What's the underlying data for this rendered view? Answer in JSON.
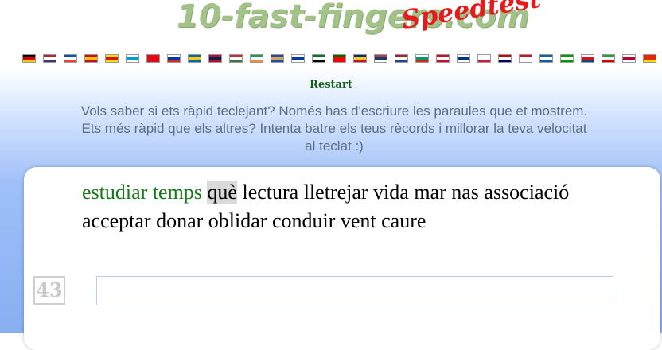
{
  "logo": {
    "main": "10-fast-fingers.com",
    "sub": "Speedtest"
  },
  "flags": [
    {
      "icon": "flag-germany-icon",
      "colors": [
        "#000000",
        "#dd0000",
        "#ffce00"
      ]
    },
    {
      "icon": "flag-usa-icon",
      "colors": [
        "#b22234",
        "#ffffff",
        "#3c3b6e"
      ]
    },
    {
      "icon": "flag-france-icon",
      "colors": [
        "#0055a4",
        "#ffffff",
        "#ef4135"
      ]
    },
    {
      "icon": "flag-spain-icon",
      "colors": [
        "#c60b1e",
        "#ffc400",
        "#c60b1e"
      ]
    },
    {
      "icon": "flag-catalonia-icon",
      "colors": [
        "#fcdd09",
        "#da121a",
        "#fcdd09"
      ]
    },
    {
      "icon": "flag-galicia-icon",
      "colors": [
        "#ffffff",
        "#0099cc",
        "#ffffff"
      ]
    },
    {
      "icon": "flag-turkey-icon",
      "colors": [
        "#e30a17",
        "#e30a17",
        "#e30a17"
      ]
    },
    {
      "icon": "flag-russia-icon",
      "colors": [
        "#ffffff",
        "#0039a6",
        "#d52b1e"
      ]
    },
    {
      "icon": "flag-sweden-icon",
      "colors": [
        "#006aa7",
        "#fecc00",
        "#006aa7"
      ]
    },
    {
      "icon": "flag-norway-icon",
      "colors": [
        "#ba0c2f",
        "#00205b",
        "#ba0c2f"
      ]
    },
    {
      "icon": "flag-hungary-icon",
      "colors": [
        "#ce2939",
        "#ffffff",
        "#477050"
      ]
    },
    {
      "icon": "flag-ireland-icon",
      "colors": [
        "#169b62",
        "#ffffff",
        "#ff883e"
      ]
    },
    {
      "icon": "flag-kosovo-icon",
      "colors": [
        "#244aa5",
        "#d0a650",
        "#244aa5"
      ]
    },
    {
      "icon": "flag-israel-icon",
      "colors": [
        "#ffffff",
        "#0038b8",
        "#ffffff"
      ]
    },
    {
      "icon": "flag-uae-icon",
      "colors": [
        "#00732f",
        "#ffffff",
        "#000000"
      ]
    },
    {
      "icon": "flag-portugal-icon",
      "colors": [
        "#006600",
        "#ff0000",
        "#ff0000"
      ]
    },
    {
      "icon": "flag-romania-icon",
      "colors": [
        "#002b7f",
        "#fcd116",
        "#ce1126"
      ]
    },
    {
      "icon": "flag-serbia-icon",
      "colors": [
        "#c6363c",
        "#0c4076",
        "#ffffff"
      ]
    },
    {
      "icon": "flag-netherlands-icon",
      "colors": [
        "#ae1c28",
        "#ffffff",
        "#21468b"
      ]
    },
    {
      "icon": "flag-bulgaria-icon",
      "colors": [
        "#ffffff",
        "#00966e",
        "#d62612"
      ]
    },
    {
      "icon": "flag-denmark-icon",
      "colors": [
        "#c8102e",
        "#ffffff",
        "#c8102e"
      ]
    },
    {
      "icon": "flag-finland-icon",
      "colors": [
        "#ffffff",
        "#003580",
        "#ffffff"
      ]
    },
    {
      "icon": "flag-poland-icon",
      "colors": [
        "#ffffff",
        "#ffffff",
        "#dc143c"
      ]
    },
    {
      "icon": "flag-malaysia-icon",
      "colors": [
        "#cc0001",
        "#ffffff",
        "#010066"
      ]
    },
    {
      "icon": "flag-indonesia-icon",
      "colors": [
        "#ce1126",
        "#ffffff",
        "#ffffff"
      ]
    },
    {
      "icon": "flag-greece-icon",
      "colors": [
        "#0d5eaf",
        "#ffffff",
        "#0d5eaf"
      ]
    },
    {
      "icon": "flag-esperanto-icon",
      "colors": [
        "#009900",
        "#ffffff",
        "#009900"
      ]
    },
    {
      "icon": "flag-czech-icon",
      "colors": [
        "#ffffff",
        "#d7141a",
        "#11457e"
      ]
    },
    {
      "icon": "flag-iran-icon",
      "colors": [
        "#239f40",
        "#ffffff",
        "#da0000"
      ]
    },
    {
      "icon": "flag-japan-icon",
      "colors": [
        "#ffffff",
        "#bc002d",
        "#ffffff"
      ]
    },
    {
      "icon": "flag-china-icon",
      "colors": [
        "#de2910",
        "#de2910",
        "#ffde00"
      ]
    }
  ],
  "restart_label": "Restart",
  "intro_text": "Vols saber si ets ràpid teclejant? Només has d'escriure les paraules que et mostrem. Ets més ràpid que els altres? Intenta batre els teus rècords i millorar la teva velocitat al teclat :)",
  "words": [
    {
      "text": "estudiar",
      "state": "done"
    },
    {
      "text": "temps",
      "state": "done"
    },
    {
      "text": "què",
      "state": "current"
    },
    {
      "text": "lectura",
      "state": "pending"
    },
    {
      "text": "lletrejar",
      "state": "pending"
    },
    {
      "text": "vida",
      "state": "pending"
    },
    {
      "text": "mar",
      "state": "pending"
    },
    {
      "text": "nas",
      "state": "pending"
    },
    {
      "text": "associació",
      "state": "pending"
    },
    {
      "text": "acceptar",
      "state": "pending"
    },
    {
      "text": "donar",
      "state": "pending"
    },
    {
      "text": "oblidar",
      "state": "pending"
    },
    {
      "text": "conduir",
      "state": "pending"
    },
    {
      "text": "vent",
      "state": "pending"
    },
    {
      "text": "caure",
      "state": "pending"
    }
  ],
  "timer": "43",
  "input": {
    "value": "",
    "placeholder": ""
  },
  "colors": {
    "done": "#147a17",
    "restart": "#0f5e16",
    "intro": "#5e6e7e",
    "logo": "#a3c28a",
    "speedtest": "#e51b1b"
  }
}
